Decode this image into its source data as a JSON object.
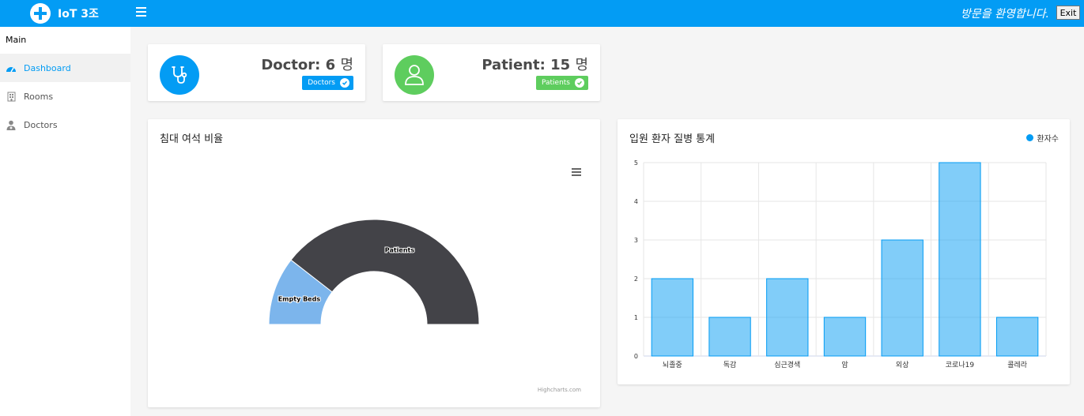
{
  "header": {
    "brand": "IoT 3조",
    "welcome": "방문을 환영합니다.",
    "exit_label": "Exit"
  },
  "sidebar": {
    "heading": "Main",
    "items": [
      {
        "label": "Dashboard",
        "icon": "dashboard-icon",
        "active": true
      },
      {
        "label": "Rooms",
        "icon": "building-icon"
      },
      {
        "label": "Doctors",
        "icon": "user-md-icon"
      }
    ]
  },
  "stats": {
    "doctor": {
      "title": "Doctor:",
      "count": "6",
      "unit": "명",
      "badge": "Doctors",
      "color": "#039cf4",
      "icon": "stethoscope-icon"
    },
    "patient": {
      "title": "Patient:",
      "count": "15",
      "unit": "명",
      "badge": "Patients",
      "color": "#5ecd5e",
      "icon": "user-icon"
    }
  },
  "bed_chart": {
    "title": "침대 여석 비율",
    "credits": "Highcharts.com"
  },
  "disease_chart": {
    "title": "입원 환자 질병 통계",
    "legend": "환자수"
  },
  "chart_data": [
    {
      "type": "pie",
      "variant": "semi-donut",
      "slices": [
        {
          "label": "Empty Beds",
          "value": 4,
          "color": "#7cb5ec"
        },
        {
          "label": "Patients",
          "value": 15,
          "color": "#434348"
        }
      ]
    },
    {
      "type": "bar",
      "categories": [
        "뇌졸중",
        "독감",
        "심근경색",
        "암",
        "외상",
        "코로나19",
        "콜레라"
      ],
      "series": [
        {
          "name": "환자수",
          "values": [
            2,
            1,
            2,
            1,
            3,
            5,
            1
          ],
          "color": "#039cf4"
        }
      ],
      "ylim": [
        0,
        5
      ],
      "yticks": [
        "0",
        "1",
        "2",
        "3",
        "4",
        "5"
      ],
      "grid": true,
      "legend": "top-right"
    }
  ]
}
